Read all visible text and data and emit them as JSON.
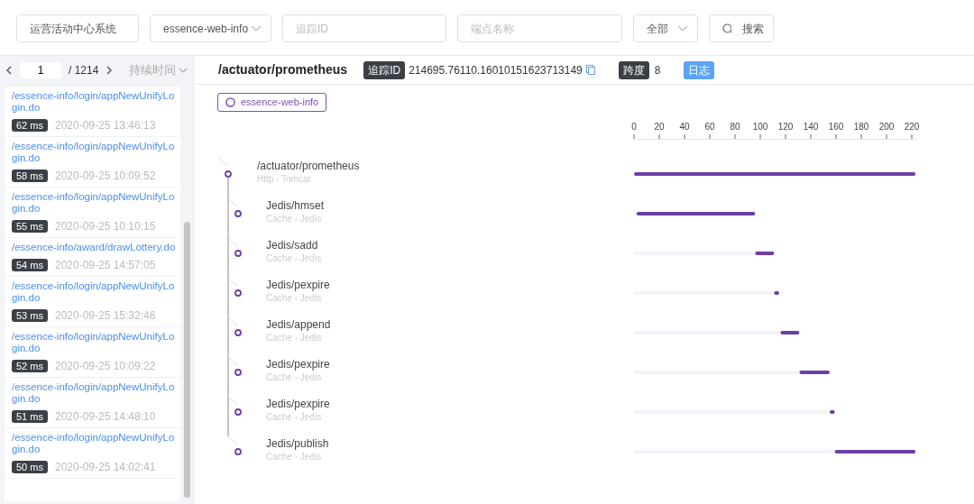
{
  "filters": {
    "system": "运营活动中心系统",
    "app": "essence-web-info",
    "trace_id": {
      "placeholder": "追踪ID"
    },
    "endpoint": {
      "placeholder": "端点名称"
    },
    "status": "全部",
    "search_button": "搜索"
  },
  "pager": {
    "page": "1",
    "total": "/ 1214",
    "sort": "持续时间"
  },
  "traces": [
    {
      "endpoint": "/essence-info/login/appNewUnifyLogin.do",
      "duration": "62 ms",
      "time": "2020-09-25 13:46:13"
    },
    {
      "endpoint": "/essence-info/login/appNewUnifyLogin.do",
      "duration": "58 ms",
      "time": "2020-09-25 10:09:52"
    },
    {
      "endpoint": "/essence-info/login/appNewUnifyLogin.do",
      "duration": "55 ms",
      "time": "2020-09-25 10:10:15"
    },
    {
      "endpoint": "/essence-info/award/drawLottery.do",
      "duration": "54 ms",
      "time": "2020-09-25 14:57:05"
    },
    {
      "endpoint": "/essence-info/login/appNewUnifyLogin.do",
      "duration": "53 ms",
      "time": "2020-09-25 15:32:46"
    },
    {
      "endpoint": "/essence-info/login/appNewUnifyLogin.do",
      "duration": "52 ms",
      "time": "2020-09-25 10:09:22"
    },
    {
      "endpoint": "/essence-info/login/appNewUnifyLogin.do",
      "duration": "51 ms",
      "time": "2020-09-25 14:48:10"
    },
    {
      "endpoint": "/essence-info/login/appNewUnifyLogin.do",
      "duration": "50 ms",
      "time": "2020-09-25 14:02:41"
    }
  ],
  "detail": {
    "title": "/actuator/prometheus",
    "trace_id_label": "追踪ID",
    "trace_id": "214695.76110.16010151623713149",
    "span_label": "跨度",
    "span_count": "8",
    "log_button": "日志",
    "service": "essence-web-info",
    "spans": [
      {
        "name": "/actuator/prometheus",
        "type": "Http - Tomcat",
        "children": [
          {
            "name": "Jedis/hmset",
            "type": "Cache - Jedis"
          },
          {
            "name": "Jedis/sadd",
            "type": "Cache - Jedis"
          },
          {
            "name": "Jedis/pexpire",
            "type": "Cache - Jedis"
          },
          {
            "name": "Jedis/append",
            "type": "Cache - Jedis"
          },
          {
            "name": "Jedis/pexpire",
            "type": "Cache - Jedis"
          },
          {
            "name": "Jedis/pexpire",
            "type": "Cache - Jedis"
          },
          {
            "name": "Jedis/publish",
            "type": "Cache - Jedis"
          }
        ]
      }
    ],
    "chart_data": {
      "type": "bar",
      "orientation": "horizontal",
      "stacked": true,
      "xlim": [
        0,
        225
      ],
      "xticks": [
        0,
        20,
        40,
        60,
        80,
        100,
        120,
        140,
        160,
        180,
        200,
        220
      ],
      "categories": [
        null,
        null,
        null,
        null,
        null,
        null,
        null,
        null
      ],
      "series": [
        {
          "color": "#f5f3f9",
          "values": [
            0,
            2,
            96,
            111,
            116,
            131,
            155,
            159
          ]
        },
        {
          "color": "#6b3fa8",
          "values": [
            223,
            94,
            15,
            4,
            15,
            24,
            4,
            64
          ]
        }
      ]
    }
  }
}
